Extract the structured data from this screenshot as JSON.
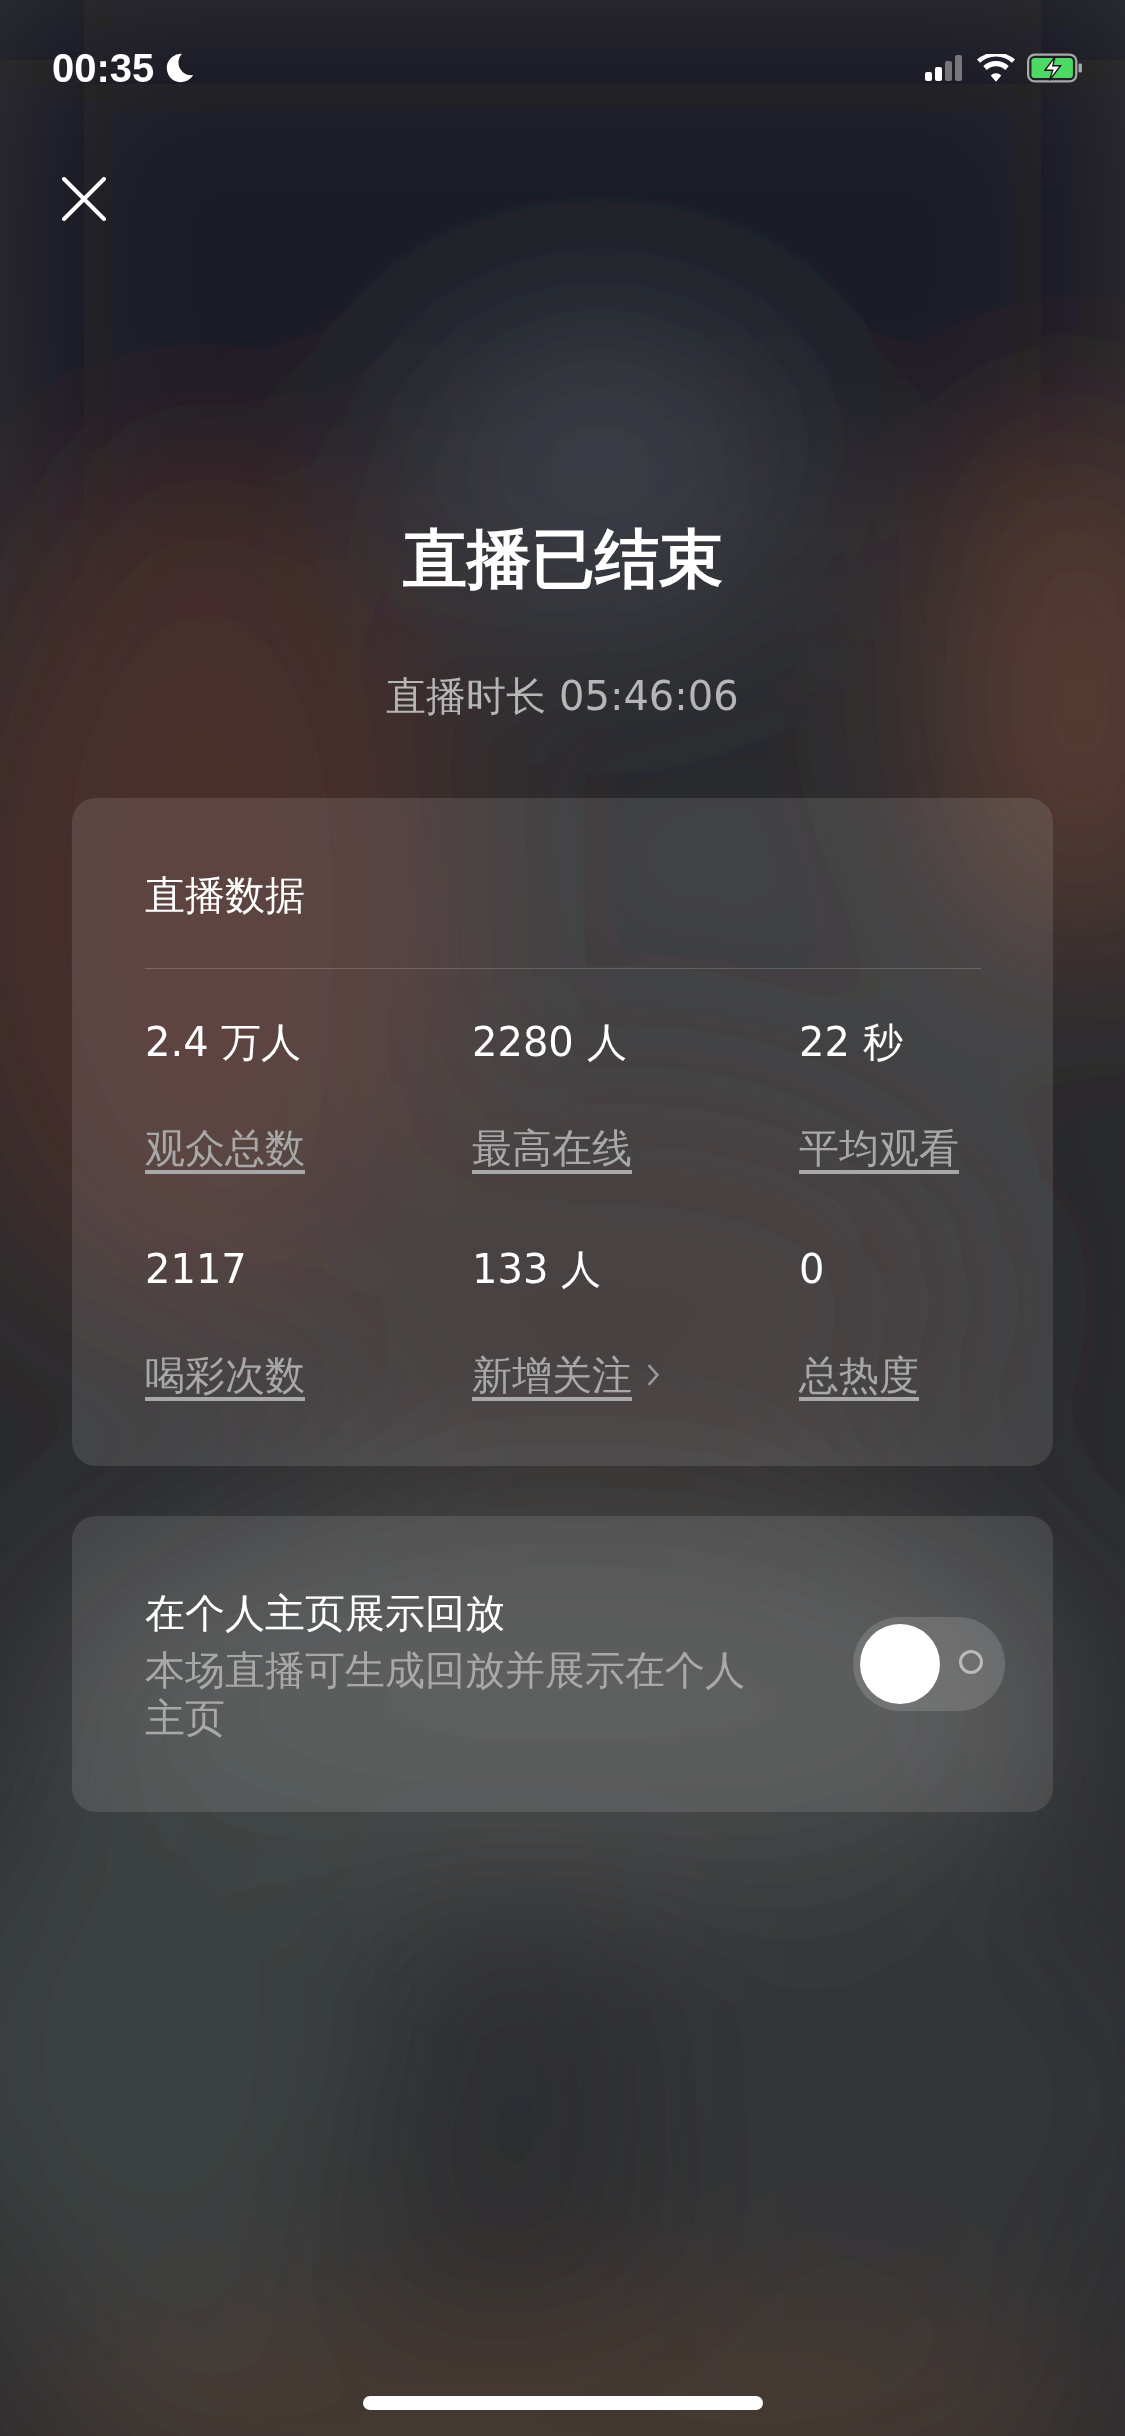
{
  "status_bar": {
    "time": "00:35",
    "do_not_disturb": true,
    "battery_charging": true
  },
  "title": "直播已结束",
  "duration": "直播时长 05:46:06",
  "stats_card": {
    "title": "直播数据",
    "stats": [
      {
        "value": "2.4 万人",
        "label": "观众总数",
        "kind": "plain"
      },
      {
        "value": "2280 人",
        "label": "最高在线",
        "kind": "plain"
      },
      {
        "value": "22 秒",
        "label": "平均观看",
        "kind": "plain"
      },
      {
        "value": "2117",
        "label": "喝彩次数",
        "kind": "plain"
      },
      {
        "value": "133 人",
        "label": "新增关注",
        "kind": "link"
      },
      {
        "value": "0",
        "label": "总热度",
        "kind": "plain"
      }
    ]
  },
  "replay_setting": {
    "title": "在个人主页展示回放",
    "description": "本场直播可生成回放并展示在个人主页",
    "on": false
  }
}
